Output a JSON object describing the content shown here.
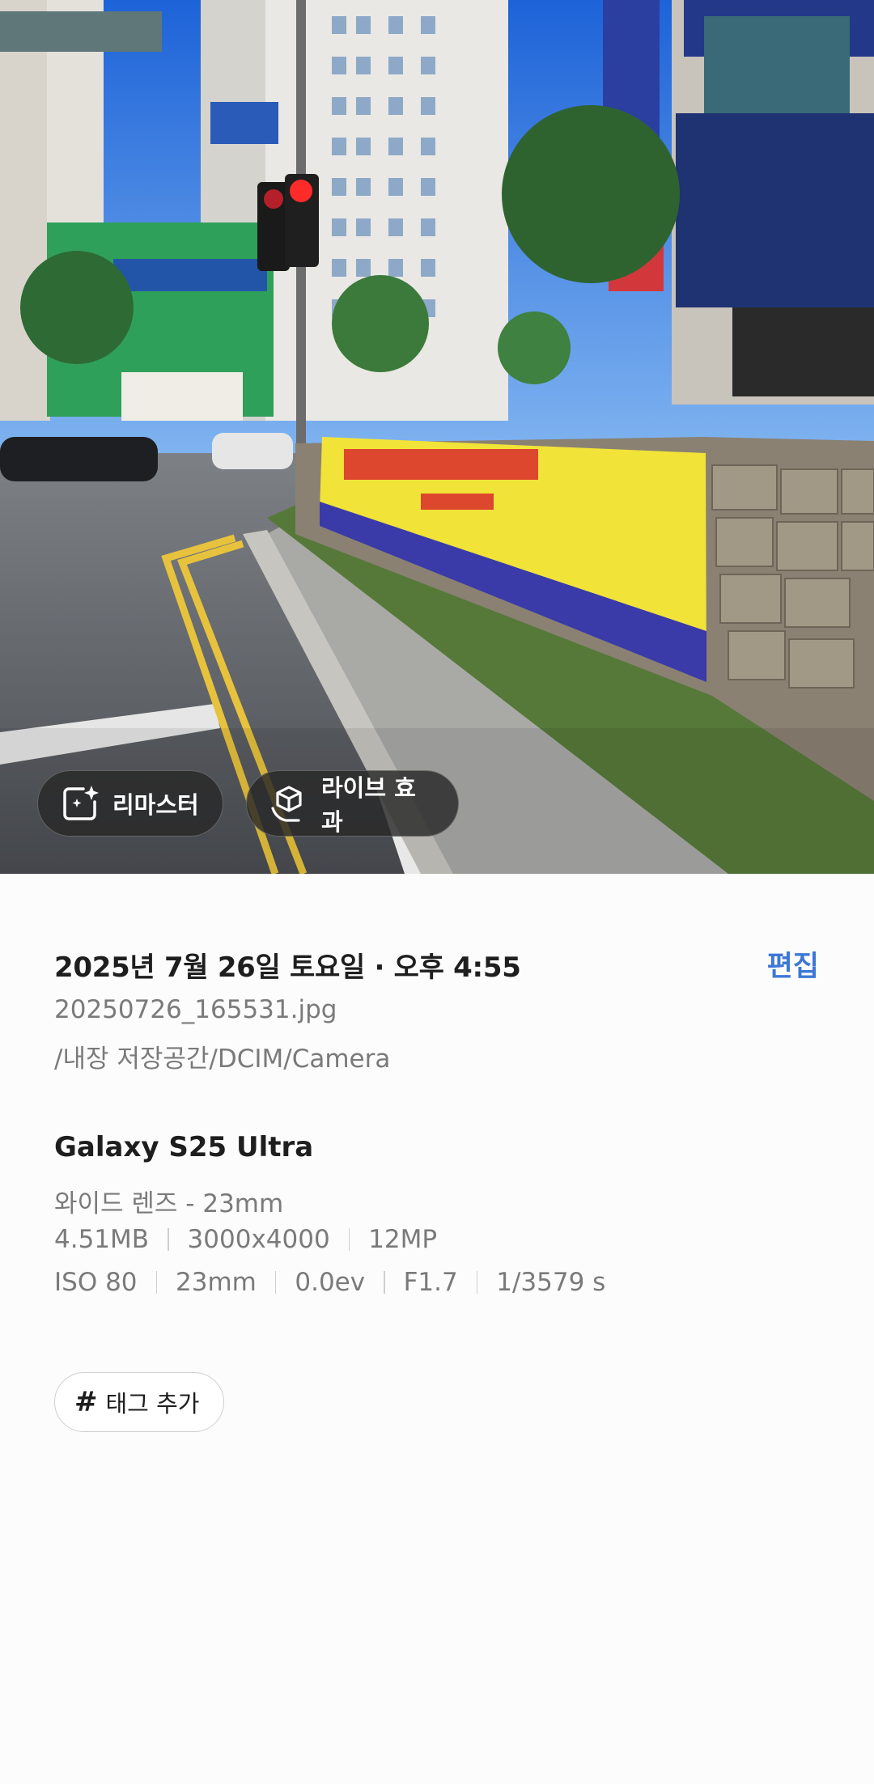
{
  "photo": {
    "remaster_label": "리마스터",
    "live_effect_label": "라이브 효과",
    "remaster_icon": "sparkle-frame-icon",
    "live_effect_icon": "cube-hand-icon"
  },
  "details": {
    "date_time": "2025년 7월 26일 토요일 · 오후 4:55",
    "edit_label": "편집",
    "file_name": "20250726_165531.jpg",
    "file_path": "/내장 저장공간/DCIM/Camera",
    "device": "Galaxy S25 Ultra",
    "lens": "와이드 렌즈 - 23mm",
    "file_size": "4.51MB",
    "resolution": "3000x4000",
    "megapixels": "12MP",
    "iso": "ISO 80",
    "focal_length": "23mm",
    "exposure_value": "0.0ev",
    "aperture": "F1.7",
    "shutter_speed": "1/3579 s",
    "add_tag_label": "태그 추가",
    "tag_icon": "hash-icon"
  },
  "colors": {
    "accent": "#3e78d6",
    "primary_text": "#1e1e1e",
    "secondary_text": "#7a7a7a",
    "background": "#fcfcfc"
  }
}
